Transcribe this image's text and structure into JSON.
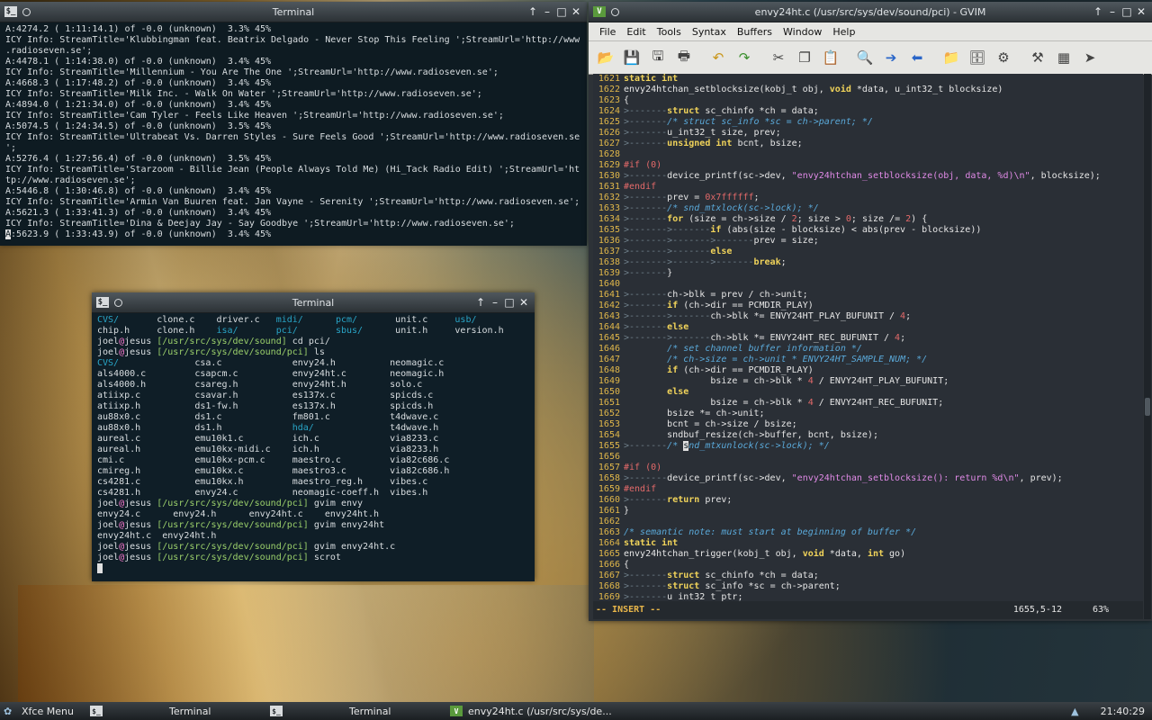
{
  "term1": {
    "title": "Terminal",
    "lines": [
      "A:4274.2 ( 1:11:14.1) of -0.0 (unknown)  3.3% 45%",
      "ICY Info: StreamTitle='Klubbingman feat. Beatrix Delgado - Never Stop This Feeling ';StreamUrl='http://www",
      ".radioseven.se';",
      "A:4478.1 ( 1:14:38.0) of -0.0 (unknown)  3.4% 45%",
      "ICY Info: StreamTitle='Millennium - You Are The One ';StreamUrl='http://www.radioseven.se';",
      "A:4668.3 ( 1:17:48.2) of -0.0 (unknown)  3.4% 45%",
      "ICY Info: StreamTitle='Milk Inc. - Walk On Water ';StreamUrl='http://www.radioseven.se';",
      "A:4894.0 ( 1:21:34.0) of -0.0 (unknown)  3.4% 45%",
      "ICY Info: StreamTitle='Cam Tyler - Feels Like Heaven ';StreamUrl='http://www.radioseven.se';",
      "A:5074.5 ( 1:24:34.5) of -0.0 (unknown)  3.5% 45%",
      "ICY Info: StreamTitle='Ultrabeat Vs. Darren Styles - Sure Feels Good ';StreamUrl='http://www.radioseven.se",
      "';",
      "A:5276.4 ( 1:27:56.4) of -0.0 (unknown)  3.5% 45%",
      "ICY Info: StreamTitle='Starzoom - Billie Jean (People Always Told Me) (Hi_Tack Radio Edit) ';StreamUrl='ht",
      "tp://www.radioseven.se';",
      "A:5446.8 ( 1:30:46.8) of -0.0 (unknown)  3.4% 45%",
      "ICY Info: StreamTitle='Armin Van Buuren feat. Jan Vayne - Serenity ';StreamUrl='http://www.radioseven.se';",
      "A:5621.3 ( 1:33:41.3) of -0.0 (unknown)  3.4% 45%",
      "ICY Info: StreamTitle='Dina & Deejay Jay - Say Goodbye ';StreamUrl='http://www.radioseven.se';"
    ],
    "last_line_cursor": "A",
    "last_line_rest": ":5623.9 ( 1:33:43.9) of -0.0 (unknown)  3.4% 45%"
  },
  "term2": {
    "title": "Terminal",
    "rows": [
      [
        [
          "CVS/",
          "d"
        ],
        [
          "clone.c",
          ""
        ],
        [
          "driver.c",
          ""
        ],
        [
          "midi/",
          "d"
        ],
        [
          "pcm/",
          "d"
        ],
        [
          "unit.c",
          ""
        ],
        [
          "usb/",
          "d"
        ]
      ],
      [
        [
          "chip.h",
          ""
        ],
        [
          "clone.h",
          ""
        ],
        [
          "isa/",
          "d"
        ],
        [
          "pci/",
          "d"
        ],
        [
          "sbus/",
          "d"
        ],
        [
          "unit.h",
          ""
        ],
        [
          "version.h",
          ""
        ]
      ]
    ],
    "prompt_user": "joel",
    "prompt_at": "@",
    "prompt_host": "jesus",
    "cmd1_path": "[/usr/src/sys/dev/sound]",
    "cmd1": " cd pci/",
    "cmd2_path": "[/usr/src/sys/dev/sound/pci]",
    "cmd2": " ls",
    "ls_rows": [
      [
        [
          "CVS/",
          "d"
        ],
        [
          "csa.c",
          ""
        ],
        [
          "envy24.h",
          ""
        ],
        [
          "neomagic.c",
          ""
        ]
      ],
      [
        [
          "als4000.c",
          ""
        ],
        [
          "csapcm.c",
          ""
        ],
        [
          "envy24ht.c",
          ""
        ],
        [
          "neomagic.h",
          ""
        ]
      ],
      [
        [
          "als4000.h",
          ""
        ],
        [
          "csareg.h",
          ""
        ],
        [
          "envy24ht.h",
          ""
        ],
        [
          "solo.c",
          ""
        ]
      ],
      [
        [
          "atiixp.c",
          ""
        ],
        [
          "csavar.h",
          ""
        ],
        [
          "es137x.c",
          ""
        ],
        [
          "spicds.c",
          ""
        ]
      ],
      [
        [
          "atiixp.h",
          ""
        ],
        [
          "ds1-fw.h",
          ""
        ],
        [
          "es137x.h",
          ""
        ],
        [
          "spicds.h",
          ""
        ]
      ],
      [
        [
          "au88x0.c",
          ""
        ],
        [
          "ds1.c",
          ""
        ],
        [
          "fm801.c",
          ""
        ],
        [
          "t4dwave.c",
          ""
        ]
      ],
      [
        [
          "au88x0.h",
          ""
        ],
        [
          "ds1.h",
          ""
        ],
        [
          "hda/",
          "d"
        ],
        [
          "t4dwave.h",
          ""
        ]
      ],
      [
        [
          "aureal.c",
          ""
        ],
        [
          "emu10k1.c",
          ""
        ],
        [
          "ich.c",
          ""
        ],
        [
          "via8233.c",
          ""
        ]
      ],
      [
        [
          "aureal.h",
          ""
        ],
        [
          "emu10kx-midi.c",
          ""
        ],
        [
          "ich.h",
          ""
        ],
        [
          "via8233.h",
          ""
        ]
      ],
      [
        [
          "cmi.c",
          ""
        ],
        [
          "emu10kx-pcm.c",
          ""
        ],
        [
          "maestro.c",
          ""
        ],
        [
          "via82c686.c",
          ""
        ]
      ],
      [
        [
          "cmireg.h",
          ""
        ],
        [
          "emu10kx.c",
          ""
        ],
        [
          "maestro3.c",
          ""
        ],
        [
          "via82c686.h",
          ""
        ]
      ],
      [
        [
          "cs4281.c",
          ""
        ],
        [
          "emu10kx.h",
          ""
        ],
        [
          "maestro_reg.h",
          ""
        ],
        [
          "vibes.c",
          ""
        ]
      ],
      [
        [
          "cs4281.h",
          ""
        ],
        [
          "envy24.c",
          ""
        ],
        [
          "neomagic-coeff.h",
          ""
        ],
        [
          "vibes.h",
          ""
        ]
      ]
    ],
    "cmd3": " gvim envy",
    "tab_complete": "envy24.c      envy24.h      envy24ht.c    envy24ht.h",
    "cmd4": " gvim envy24ht",
    "tab_complete2": "envy24ht.c  envy24ht.h",
    "cmd5": " gvim envy24ht.c",
    "cmd6": " scrot"
  },
  "gvim": {
    "title": "envy24ht.c (/usr/src/sys/dev/sound/pci) - GVIM",
    "menu": [
      "File",
      "Edit",
      "Tools",
      "Syntax",
      "Buffers",
      "Window",
      "Help"
    ],
    "toolbar_icons": [
      "open-icon",
      "save-icon",
      "save-all-icon",
      "print-icon",
      "sep",
      "undo-icon",
      "redo-icon",
      "sep",
      "cut-icon",
      "copy-icon",
      "paste-icon",
      "sep",
      "find-replace-icon",
      "find-next-icon",
      "find-prev-icon",
      "sep",
      "load-session-icon",
      "save-session-icon",
      "run-script-icon",
      "sep",
      "make-icon",
      "shell-icon",
      "tags-icon"
    ],
    "lines": [
      {
        "n": "1621",
        "t": [
          [
            "static int",
            "kw"
          ]
        ]
      },
      {
        "n": "1622",
        "t": [
          [
            "envy24htchan_setblocksize(kobj_t obj, ",
            ""
          ],
          [
            "void",
            "kw"
          ],
          [
            " *data, u_int32_t blocksize)",
            ""
          ]
        ]
      },
      {
        "n": "1623",
        "t": [
          [
            "{",
            ""
          ]
        ]
      },
      {
        "n": "1624",
        "t": [
          [
            ">-------",
            "tab"
          ],
          [
            "struct",
            "kw"
          ],
          [
            " sc_chinfo *ch = data;",
            ""
          ]
        ]
      },
      {
        "n": "1625",
        "t": [
          [
            ">-------",
            "tab"
          ],
          [
            "/* struct sc_info *sc = ch->parent; */",
            "comment"
          ]
        ]
      },
      {
        "n": "1626",
        "t": [
          [
            ">-------",
            "tab"
          ],
          [
            "u_int32_t size, prev;",
            ""
          ]
        ]
      },
      {
        "n": "1627",
        "t": [
          [
            ">-------",
            "tab"
          ],
          [
            "unsigned int",
            "kw"
          ],
          [
            " bcnt, bsize;",
            ""
          ]
        ]
      },
      {
        "n": "1628",
        "t": []
      },
      {
        "n": "1629",
        "t": [
          [
            "#if",
            "pre"
          ],
          [
            " (",
            "pre"
          ],
          [
            "0",
            "num"
          ],
          [
            ")",
            "pre"
          ]
        ]
      },
      {
        "n": "1630",
        "t": [
          [
            ">-------",
            "tab"
          ],
          [
            "device_printf(sc->dev, ",
            ""
          ],
          [
            "\"envy24htchan_setblocksize(obj, data, %d)\\n\"",
            "string"
          ],
          [
            ", blocksize);",
            ""
          ]
        ]
      },
      {
        "n": "1631",
        "t": [
          [
            "#endif",
            "pre"
          ]
        ]
      },
      {
        "n": "1632",
        "t": [
          [
            ">-------",
            "tab"
          ],
          [
            "prev = ",
            ""
          ],
          [
            "0x7ffffff",
            "num"
          ],
          [
            ";",
            ""
          ]
        ]
      },
      {
        "n": "1633",
        "t": [
          [
            ">-------",
            "tab"
          ],
          [
            "/* snd_mtxlock(sc->lock); */",
            "comment"
          ]
        ]
      },
      {
        "n": "1634",
        "t": [
          [
            ">-------",
            "tab"
          ],
          [
            "for",
            "kw"
          ],
          [
            " (size = ch->size / ",
            ""
          ],
          [
            "2",
            "num"
          ],
          [
            "; size > ",
            ""
          ],
          [
            "0",
            "num"
          ],
          [
            "; size /= ",
            ""
          ],
          [
            "2",
            "num"
          ],
          [
            ") {",
            ""
          ]
        ]
      },
      {
        "n": "1635",
        "t": [
          [
            ">------->-------",
            "tab"
          ],
          [
            "if",
            "kw"
          ],
          [
            " (abs(size - blocksize) < abs(prev - blocksize))",
            ""
          ]
        ]
      },
      {
        "n": "1636",
        "t": [
          [
            ">------->------->-------",
            "tab"
          ],
          [
            "prev = size;",
            ""
          ]
        ]
      },
      {
        "n": "1637",
        "t": [
          [
            ">------->-------",
            "tab"
          ],
          [
            "else",
            "kw"
          ]
        ]
      },
      {
        "n": "1638",
        "t": [
          [
            ">------->------->-------",
            "tab"
          ],
          [
            "break",
            "kw"
          ],
          [
            ";",
            ""
          ]
        ]
      },
      {
        "n": "1639",
        "t": [
          [
            ">-------",
            "tab"
          ],
          [
            "}",
            ""
          ]
        ]
      },
      {
        "n": "1640",
        "t": []
      },
      {
        "n": "1641",
        "t": [
          [
            ">-------",
            "tab"
          ],
          [
            "ch->blk = prev / ch->unit;",
            ""
          ]
        ]
      },
      {
        "n": "1642",
        "t": [
          [
            ">-------",
            "tab"
          ],
          [
            "if",
            "kw"
          ],
          [
            " (ch->dir == PCMDIR_PLAY)",
            ""
          ]
        ]
      },
      {
        "n": "1643",
        "t": [
          [
            ">------->-------",
            "tab"
          ],
          [
            "ch->blk *= ENVY24HT_PLAY_BUFUNIT / ",
            ""
          ],
          [
            "4",
            "num"
          ],
          [
            ";",
            ""
          ]
        ]
      },
      {
        "n": "1644",
        "t": [
          [
            ">-------",
            "tab"
          ],
          [
            "else",
            "kw"
          ]
        ]
      },
      {
        "n": "1645",
        "t": [
          [
            ">------->-------",
            "tab"
          ],
          [
            "ch->blk *= ENVY24HT_REC_BUFUNIT / ",
            ""
          ],
          [
            "4",
            "num"
          ],
          [
            ";",
            ""
          ]
        ]
      },
      {
        "n": "1646",
        "t": [
          [
            "        ",
            ""
          ],
          [
            "/* set channel buffer information */",
            "comment"
          ]
        ]
      },
      {
        "n": "1647",
        "t": [
          [
            "        ",
            ""
          ],
          [
            "/* ch->size = ch->unit * ENVY24HT_SAMPLE_NUM; */",
            "comment"
          ]
        ]
      },
      {
        "n": "1648",
        "t": [
          [
            "        ",
            ""
          ],
          [
            "if",
            "kw"
          ],
          [
            " (ch->dir == PCMDIR_PLAY)",
            ""
          ]
        ]
      },
      {
        "n": "1649",
        "t": [
          [
            "                bsize = ch->blk * ",
            ""
          ],
          [
            "4",
            "num"
          ],
          [
            " / ENVY24HT_PLAY_BUFUNIT;",
            ""
          ]
        ]
      },
      {
        "n": "1650",
        "t": [
          [
            "        ",
            ""
          ],
          [
            "else",
            "kw"
          ]
        ]
      },
      {
        "n": "1651",
        "t": [
          [
            "                bsize = ch->blk * ",
            ""
          ],
          [
            "4",
            "num"
          ],
          [
            " / ENVY24HT_REC_BUFUNIT;",
            ""
          ]
        ]
      },
      {
        "n": "1652",
        "t": [
          [
            "        bsize *= ch->unit;",
            ""
          ]
        ]
      },
      {
        "n": "1653",
        "t": [
          [
            "        bcnt = ch->size / bsize;",
            ""
          ]
        ]
      },
      {
        "n": "1654",
        "t": [
          [
            "        sndbuf_resize(ch->buffer, bcnt, bsize);",
            ""
          ]
        ]
      },
      {
        "n": "1655",
        "t": [
          [
            ">-------",
            "tab"
          ],
          [
            "/* ",
            "comment"
          ],
          [
            "s",
            "cursor"
          ],
          [
            "nd_mtxunlock(sc->lock); */",
            "comment"
          ]
        ]
      },
      {
        "n": "1656",
        "t": []
      },
      {
        "n": "1657",
        "t": [
          [
            "#if",
            "pre"
          ],
          [
            " (",
            "pre"
          ],
          [
            "0",
            "num"
          ],
          [
            ")",
            "pre"
          ]
        ]
      },
      {
        "n": "1658",
        "t": [
          [
            ">-------",
            "tab"
          ],
          [
            "device_printf(sc->dev, ",
            ""
          ],
          [
            "\"envy24htchan_setblocksize(): return %d\\n\"",
            "string"
          ],
          [
            ", prev);",
            ""
          ]
        ]
      },
      {
        "n": "1659",
        "t": [
          [
            "#endif",
            "pre"
          ]
        ]
      },
      {
        "n": "1660",
        "t": [
          [
            ">-------",
            "tab"
          ],
          [
            "return",
            "kw"
          ],
          [
            " prev;",
            ""
          ]
        ]
      },
      {
        "n": "1661",
        "t": [
          [
            "}",
            ""
          ]
        ]
      },
      {
        "n": "1662",
        "t": []
      },
      {
        "n": "1663",
        "t": [
          [
            "/* semantic note: must start at beginning of buffer */",
            "comment"
          ]
        ]
      },
      {
        "n": "1664",
        "t": [
          [
            "static int",
            "kw"
          ]
        ]
      },
      {
        "n": "1665",
        "t": [
          [
            "envy24htchan_trigger(kobj_t obj, ",
            ""
          ],
          [
            "void",
            "kw"
          ],
          [
            " *data, ",
            ""
          ],
          [
            "int",
            "kw"
          ],
          [
            " go)",
            ""
          ]
        ]
      },
      {
        "n": "1666",
        "t": [
          [
            "{",
            ""
          ]
        ]
      },
      {
        "n": "1667",
        "t": [
          [
            ">-------",
            "tab"
          ],
          [
            "struct",
            "kw"
          ],
          [
            " sc_chinfo *ch = data;",
            ""
          ]
        ]
      },
      {
        "n": "1668",
        "t": [
          [
            ">-------",
            "tab"
          ],
          [
            "struct",
            "kw"
          ],
          [
            " sc_info *sc = ch->parent;",
            ""
          ]
        ]
      },
      {
        "n": "1669",
        "t": [
          [
            ">-------",
            "tab"
          ],
          [
            "u_int32_t ptr;",
            ""
          ]
        ]
      }
    ],
    "mode": "-- INSERT --",
    "position": "1655,5-12",
    "percent": "63%"
  },
  "taskbar": {
    "menu": "Xfce Menu",
    "items": [
      "Terminal",
      "Terminal",
      "envy24ht.c (/usr/src/sys/de..."
    ],
    "clock": "21:40:29"
  }
}
